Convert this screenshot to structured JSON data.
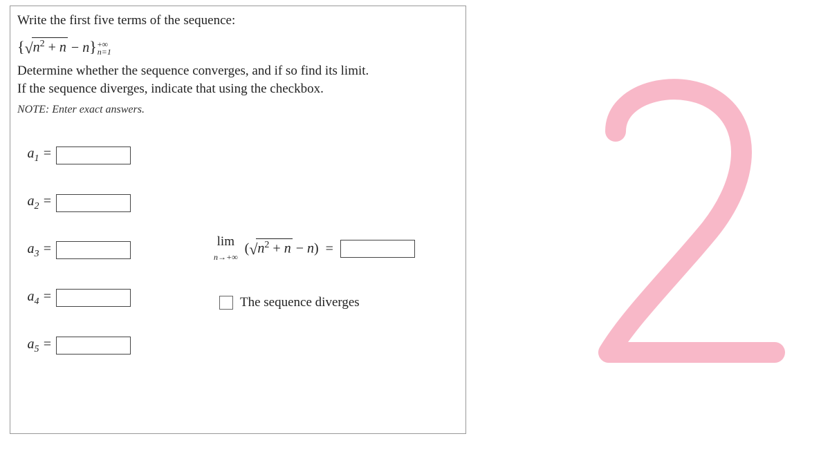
{
  "problem": {
    "prompt_line1": "Write the first five terms of the sequence:",
    "sequence_tex_plain": "{√(n² + n) − n}",
    "sequence_sup": "+∞",
    "sequence_sub": "n=1",
    "instruction_line1": "Determine whether the sequence converges, and if so find its limit.",
    "instruction_line2": "If the sequence diverges, indicate that using the checkbox.",
    "note": "NOTE:  Enter exact answers."
  },
  "terms": {
    "a1": {
      "label": "a₁ =",
      "value": ""
    },
    "a2": {
      "label": "a₂ =",
      "value": ""
    },
    "a3": {
      "label": "a₃ =",
      "value": ""
    },
    "a4": {
      "label": "a₄ =",
      "value": ""
    },
    "a5": {
      "label": "a₅ =",
      "value": ""
    }
  },
  "limit": {
    "lim_word": "lim",
    "lim_sub": "n→+∞",
    "expr_inside": "√(n² + n) − n",
    "equals": "=",
    "value": ""
  },
  "checkbox": {
    "label": "The sequence diverges",
    "checked": false
  },
  "annotation": {
    "glyph": "2",
    "color": "#f8b8c8"
  }
}
